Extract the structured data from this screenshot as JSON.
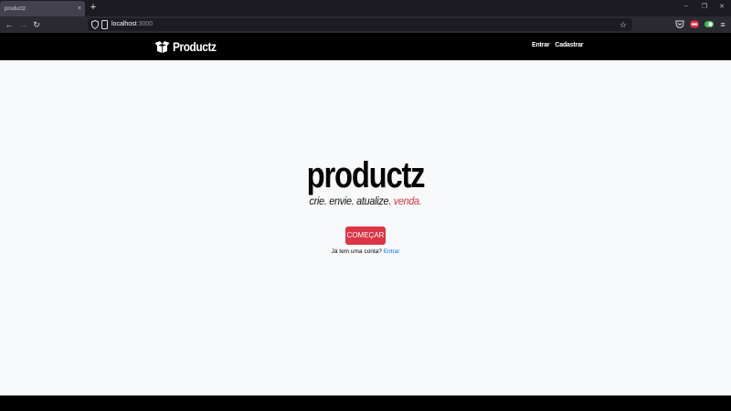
{
  "browser": {
    "tab": {
      "title": "productz",
      "close_icon": "×"
    },
    "new_tab_icon": "+",
    "window_controls": {
      "minimize": "–",
      "restore": "❐",
      "close": "✕"
    },
    "nav": {
      "back": "←",
      "forward": "→",
      "reload": "↻"
    },
    "url": {
      "host": "localhost",
      "port": ":3000"
    },
    "bookmark_icon": "☆",
    "menu_icon": "≡"
  },
  "site": {
    "brand": "Productz",
    "nav_links": [
      "Entrar",
      "Cadastrar"
    ]
  },
  "hero": {
    "title": "productz",
    "tagline_main": "crie. envie. atualize. ",
    "tagline_accent": "venda.",
    "cta_label": "COMEÇAR",
    "login_prompt": "Já tem uma conta? ",
    "login_link": "Entrar"
  },
  "colors": {
    "accent": "#dc3545",
    "link": "#0d6efd",
    "header_bg": "#000000",
    "page_bg": "#f8f9fa"
  }
}
